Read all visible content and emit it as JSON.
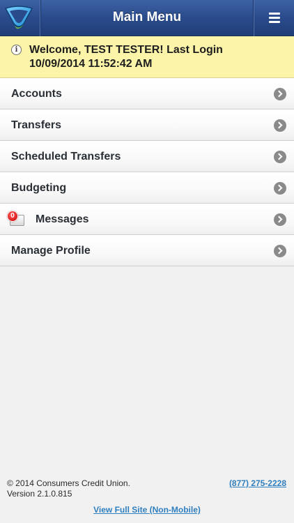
{
  "header": {
    "title": "Main Menu",
    "logo_icon": "logo-icon",
    "menu_icon": "hamburger-menu-icon"
  },
  "banner": {
    "info_icon": "info-icon",
    "info_glyph": "i",
    "line1": "Welcome, TEST TESTER! Last Login",
    "line2": "10/09/2014 11:52:42 AM"
  },
  "menu": {
    "items": [
      {
        "label": "Accounts"
      },
      {
        "label": "Transfers"
      },
      {
        "label": "Scheduled Transfers"
      },
      {
        "label": "Budgeting"
      },
      {
        "label": "Messages",
        "badge": "0",
        "icon": "envelope-icon"
      },
      {
        "label": "Manage Profile"
      }
    ],
    "chevron_icon": "chevron-right-icon"
  },
  "footer": {
    "copyright": "© 2014 Consumers Credit Union.",
    "version": "Version 2.1.0.815",
    "phone": "(877) 275-2228",
    "full_site": "View Full Site (Non-Mobile)"
  },
  "colors": {
    "header_blue": "#2a4b8b",
    "banner_yellow": "#fbf4a9",
    "link_blue": "#2f7fbf",
    "badge_red": "#c80000"
  }
}
